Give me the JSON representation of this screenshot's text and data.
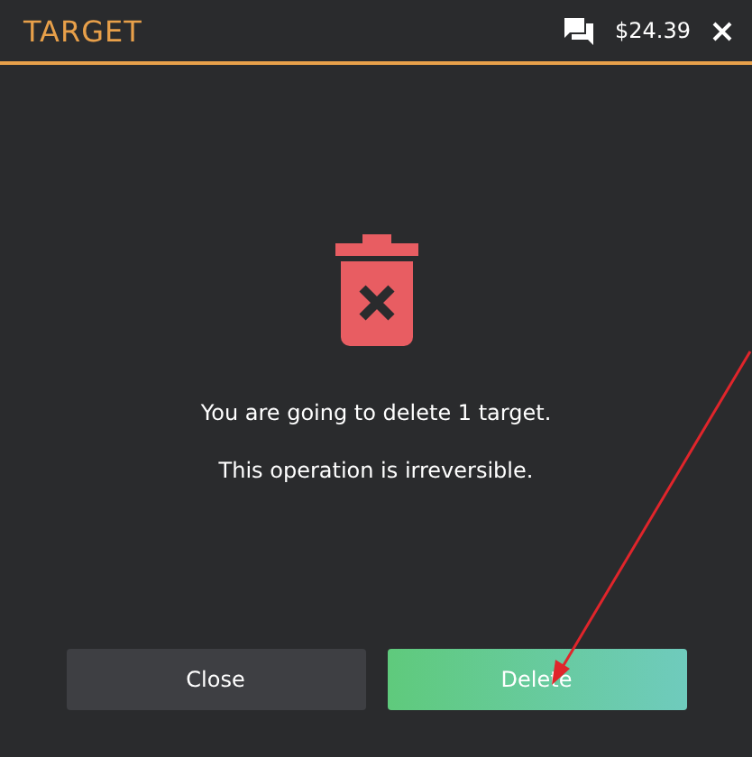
{
  "header": {
    "title": "TARGET",
    "balance": "$24.39"
  },
  "dialog": {
    "messages": [
      "You are going to delete 1 target.",
      "This operation is irreversible."
    ],
    "buttons": [
      {
        "label": "Close",
        "kind": "secondary"
      },
      {
        "label": "Delete",
        "kind": "primary"
      }
    ]
  }
}
